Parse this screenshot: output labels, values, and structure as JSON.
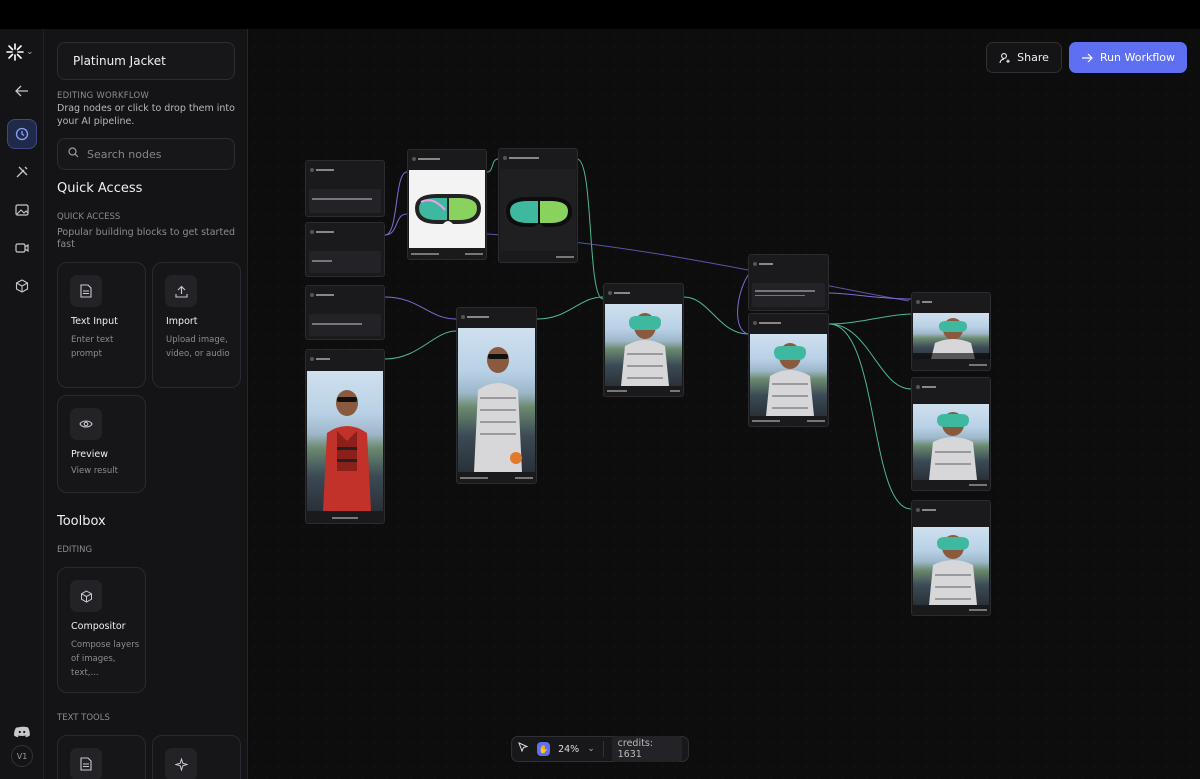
{
  "workflow": {
    "name": "Platinum Jacket",
    "editing_label": "EDITING WORKFLOW",
    "editing_desc": "Drag nodes or click to drop them into your AI pipeline."
  },
  "search": {
    "placeholder": "Search nodes"
  },
  "quick_access": {
    "heading": "Quick Access",
    "caption": "QUICK ACCESS",
    "desc": "Popular building blocks to get started fast",
    "cards": [
      {
        "title": "Text Input",
        "desc": "Enter text prompt",
        "icon": "document-icon"
      },
      {
        "title": "Import",
        "desc": "Upload image, video, or audio",
        "icon": "upload-icon"
      },
      {
        "title": "Preview",
        "desc": "View result",
        "icon": "eye-icon"
      }
    ]
  },
  "toolbox": {
    "heading": "Toolbox",
    "editing_caption": "EDITING",
    "cards": [
      {
        "title": "Compositor",
        "desc": "Compose layers of images, text,...",
        "icon": "cube-icon"
      }
    ],
    "text_tools_caption": "TEXT TOOLS"
  },
  "rail": {
    "version": "V1"
  },
  "header": {
    "share_label": "Share",
    "run_label": "Run Workflow"
  },
  "toolbar": {
    "zoom": "24%",
    "credits": "credits: 1631"
  },
  "colors": {
    "accent": "#5e6ff2",
    "edge_green": "#4fb98f",
    "edge_purple": "#7a6fd6"
  }
}
